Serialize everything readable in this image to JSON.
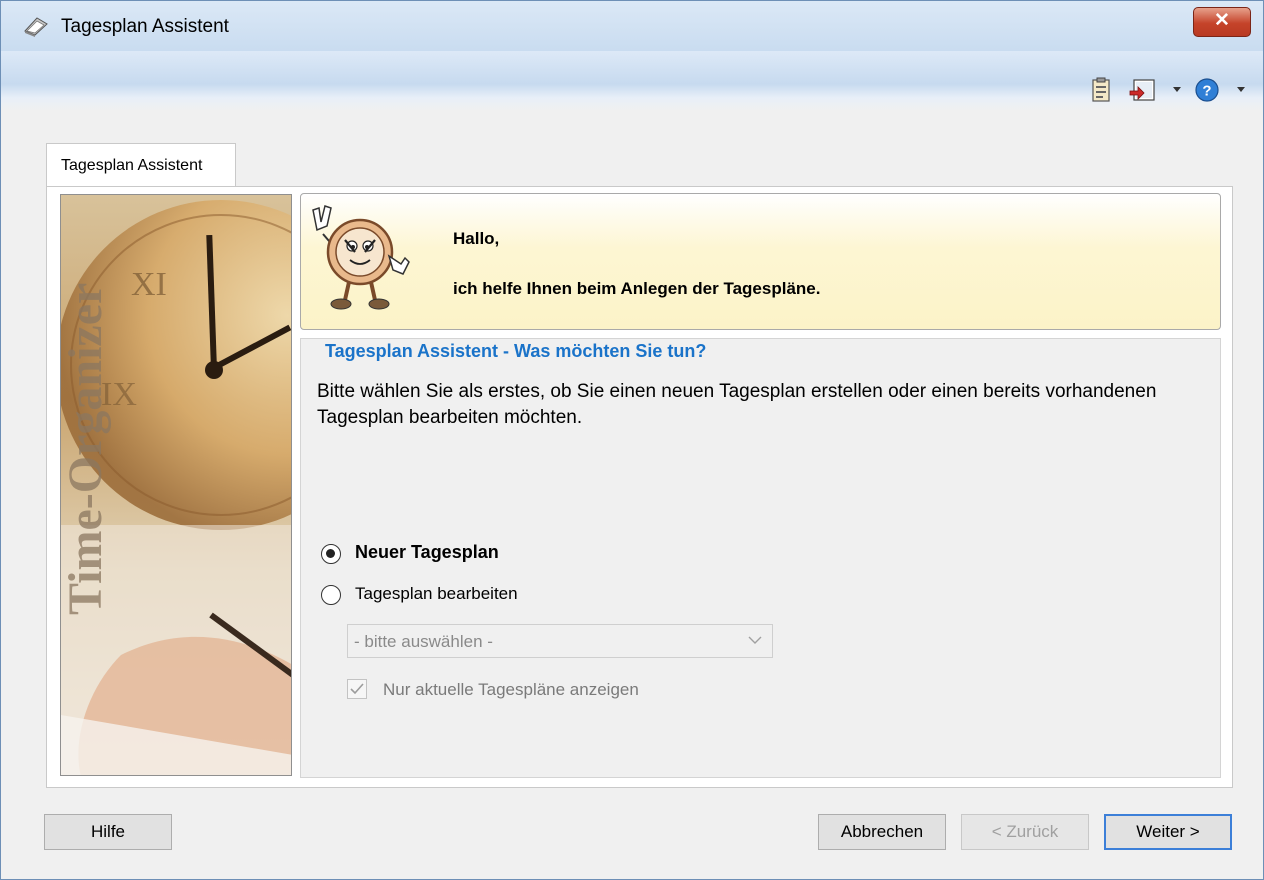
{
  "window": {
    "title": "Tagesplan Assistent",
    "close_label": "✕"
  },
  "toolbar": {
    "icons": [
      "clipboard-icon",
      "exit-door-icon",
      "dropdown-arrow-icon",
      "help-icon",
      "dropdown-arrow-icon"
    ]
  },
  "tab": {
    "label": "Tagesplan Assistent"
  },
  "sidebar_image": {
    "watermark": "Time-Organizer"
  },
  "header": {
    "greeting": "Hallo,",
    "message": "ich helfe Ihnen beim Anlegen der Tagespläne."
  },
  "group": {
    "title": "Tagesplan Assistent - Was möchten Sie tun?",
    "description": "Bitte wählen Sie als erstes, ob Sie einen neuen Tagesplan erstellen oder einen bereits vorhandenen Tagesplan bearbeiten möchten."
  },
  "options": {
    "new_plan": {
      "label": "Neuer Tagesplan",
      "selected": true
    },
    "edit_plan": {
      "label": "Tagesplan bearbeiten",
      "selected": false
    }
  },
  "plan_select": {
    "value": "- bitte auswählen -",
    "enabled": false
  },
  "current_only": {
    "label": "Nur aktuelle Tagespläne anzeigen",
    "checked": true,
    "enabled": false
  },
  "buttons": {
    "help": "Hilfe",
    "cancel": "Abbrechen",
    "back": "< Zurück",
    "next": "Weiter >"
  },
  "colors": {
    "accent": "#1a73c9",
    "header_bg": "#fcf3c8",
    "close_button": "#c5432a",
    "default_button_border": "#3c7fd8"
  }
}
